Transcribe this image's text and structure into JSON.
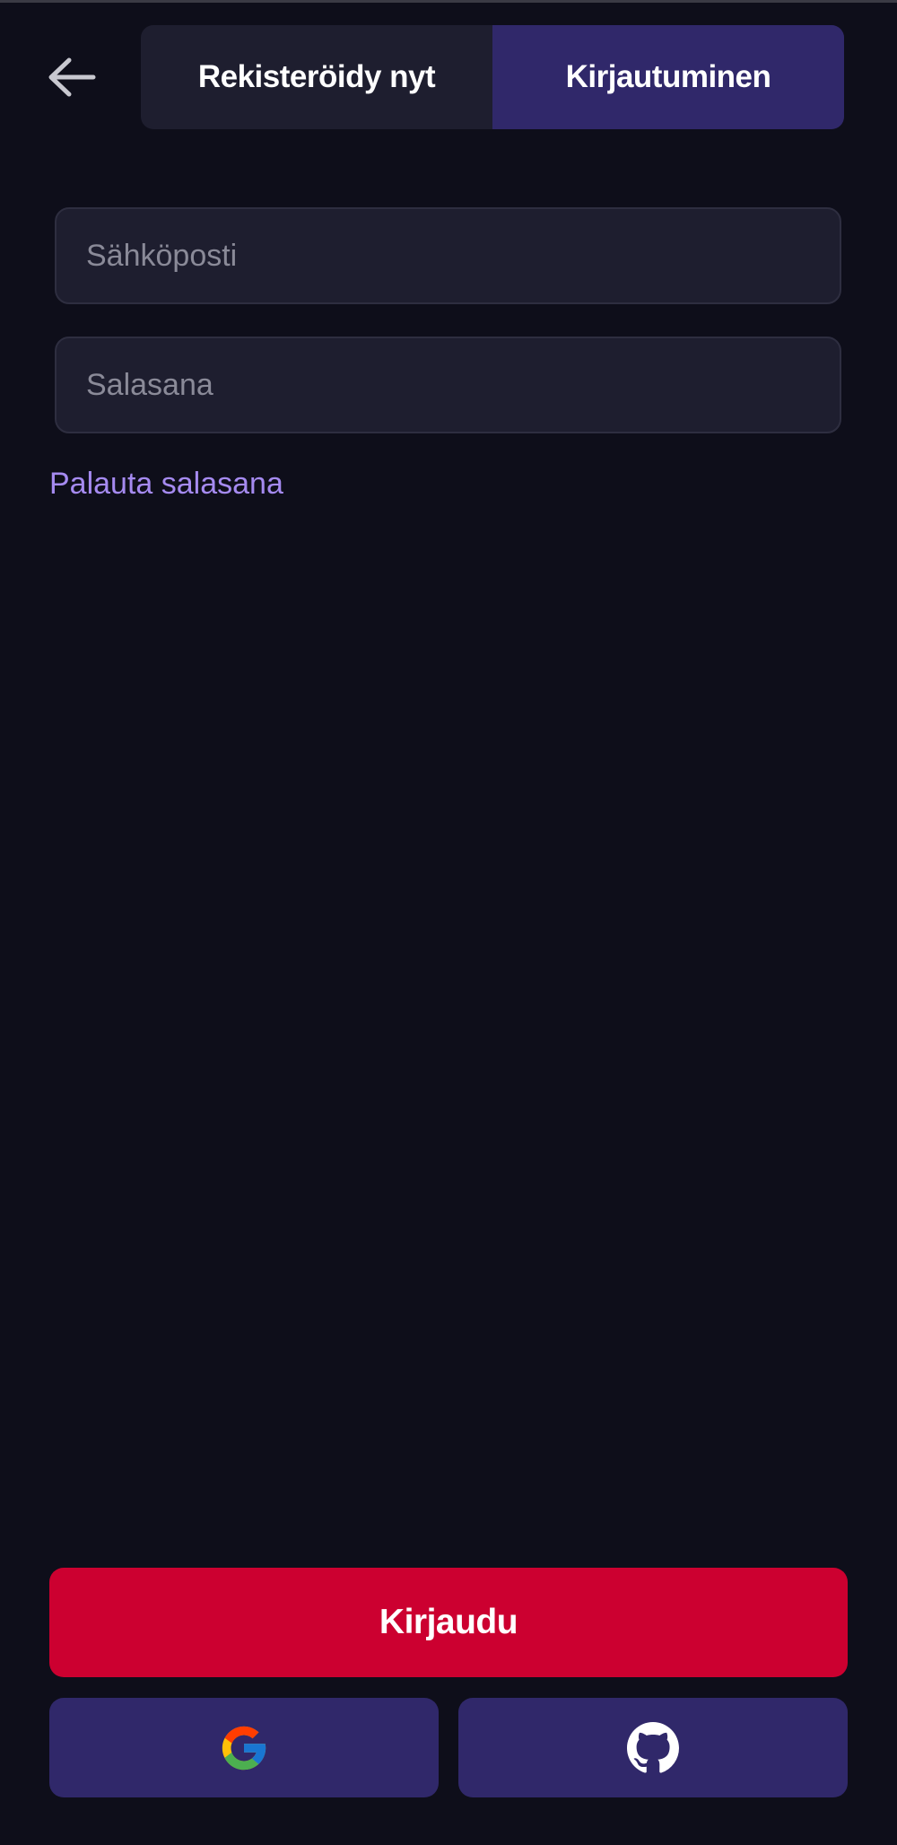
{
  "header": {
    "back_icon": "arrow-left-icon",
    "tabs": [
      {
        "label": "Rekisteröidy nyt",
        "active": false
      },
      {
        "label": "Kirjautuminen",
        "active": true
      }
    ]
  },
  "form": {
    "email": {
      "placeholder": "Sähköposti",
      "value": ""
    },
    "password": {
      "placeholder": "Salasana",
      "value": ""
    },
    "forgot_password_label": "Palauta salasana"
  },
  "actions": {
    "login_label": "Kirjaudu",
    "social": [
      {
        "provider_icon": "google-icon"
      },
      {
        "provider_icon": "github-icon"
      }
    ]
  },
  "colors": {
    "background": "#0e0e1a",
    "surface": "#1e1e2f",
    "accent_purple": "#30286a",
    "link": "#a58af0",
    "primary_red": "#cc0030"
  }
}
